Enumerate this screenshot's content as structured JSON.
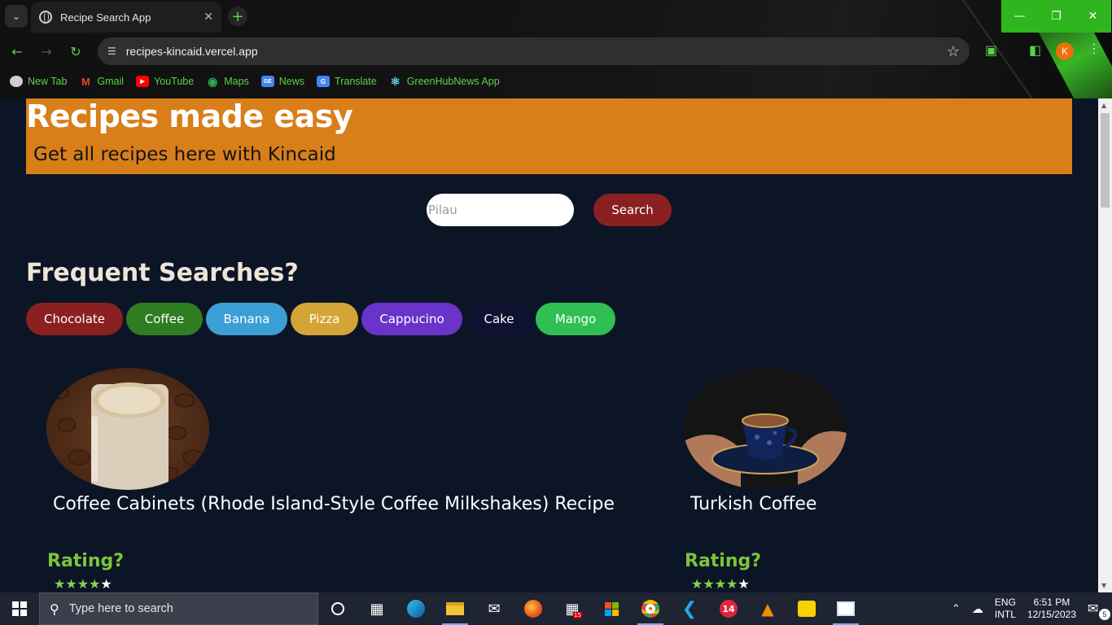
{
  "browser": {
    "tab_title": "Recipe Search App",
    "url": "recipes-kincaid.vercel.app",
    "profile_initial": "K",
    "bookmarks": [
      {
        "label": "New Tab",
        "icon": "globe-icon",
        "color": "#cfcfcf"
      },
      {
        "label": "Gmail",
        "icon": "gmail-icon",
        "color": "#ea4335"
      },
      {
        "label": "YouTube",
        "icon": "youtube-icon",
        "color": "#ff0000"
      },
      {
        "label": "Maps",
        "icon": "maps-pin-icon",
        "color": "#34a853"
      },
      {
        "label": "News",
        "icon": "google-news-icon",
        "color": "#4285f4"
      },
      {
        "label": "Translate",
        "icon": "google-translate-icon",
        "color": "#4285f4"
      },
      {
        "label": "GreenHubNews App",
        "icon": "react-icon",
        "color": "#61dafb"
      }
    ]
  },
  "hero": {
    "title": "Recipes made easy",
    "subtitle": "Get all recipes here with Kincaid"
  },
  "search": {
    "placeholder": "Pilau",
    "button_label": "Search"
  },
  "frequent": {
    "title": "Frequent Searches?",
    "chips": [
      {
        "label": "Chocolate",
        "color": "#8a2020"
      },
      {
        "label": "Coffee",
        "color": "#2e7d22"
      },
      {
        "label": "Banana",
        "color": "#3b9fd6"
      },
      {
        "label": "Pizza",
        "color": "#d4a437"
      },
      {
        "label": "Cappucino",
        "color": "#6a33c9"
      },
      {
        "label": "Cake",
        "color": "#0f1130"
      },
      {
        "label": "Mango",
        "color": "#2fbf52"
      }
    ]
  },
  "recipes": [
    {
      "name": "Coffee Cabinets (Rhode Island-Style Coffee Milkshakes) Recipe",
      "rating_label": "Rating?",
      "stars": 4,
      "max_stars": 5
    },
    {
      "name": "Turkish Coffee",
      "rating_label": "Rating?",
      "stars": 4,
      "max_stars": 5
    }
  ],
  "taskbar": {
    "search_placeholder": "Type here to search",
    "lang_line1": "ENG",
    "lang_line2": "INTL",
    "time": "6:51 PM",
    "date": "12/15/2023",
    "notification_count": "5",
    "mail_badge": "15",
    "calendar_badge": "14"
  },
  "colors": {
    "page_bg": "#0b1526",
    "hero_bg": "#d87f1a",
    "accent_green": "#5bd34a",
    "rating_green": "#7cc43a"
  }
}
